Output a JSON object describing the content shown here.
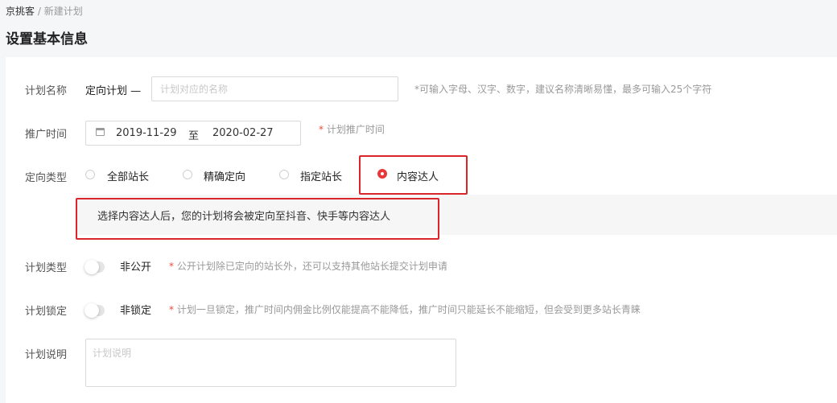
{
  "breadcrumb": {
    "root": "京挑客",
    "separator": "/",
    "current": "新建计划"
  },
  "page_title": "设置基本信息",
  "form": {
    "plan_name": {
      "label": "计划名称",
      "prefix": "定向计划 —",
      "placeholder": "计划对应的名称",
      "hint": "*可输入字母、汉字、数字，建议名称清晰易懂，最多可输入25个字符"
    },
    "promo_time": {
      "label": "推广时间",
      "start_date": "2019-11-29",
      "range_separator": "至",
      "end_date": "2020-02-27",
      "hint_mark": "*",
      "hint": "计划推广时间"
    },
    "target_type": {
      "label": "定向类型",
      "options": [
        "全部站长",
        "精确定向",
        "指定站长",
        "内容达人"
      ],
      "selected": "内容达人",
      "tip": "选择内容达人后，您的计划将会被定向至抖音、快手等内容达人"
    },
    "plan_type": {
      "label": "计划类型",
      "switch_label": "非公开",
      "switch_on": false,
      "hint_mark": "*",
      "hint": "公开计划除已定向的站长外，还可以支持其他站长提交计划申请"
    },
    "plan_lock": {
      "label": "计划锁定",
      "switch_label": "非锁定",
      "switch_on": false,
      "hint_mark": "*",
      "hint": "计划一旦锁定，推广时间内佣金比例仅能提高不能降低，推广时间只能延长不能缩短，但会受到更多站长青睐"
    },
    "plan_desc": {
      "label": "计划说明",
      "placeholder": "计划说明"
    }
  },
  "colors": {
    "accent_red": "#e8393a",
    "highlight_border": "#d9262b",
    "hint_gray": "#999999",
    "page_bg": "#f5f6f8"
  },
  "icons": {
    "date": "calendar-icon"
  }
}
